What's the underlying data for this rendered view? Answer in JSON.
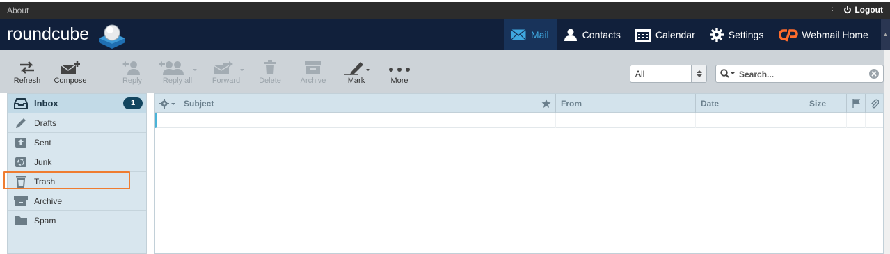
{
  "topbar": {
    "about": "About",
    "separator": ":",
    "logout": "Logout"
  },
  "header": {
    "logo": "roundcube",
    "nav": [
      {
        "label": "Mail",
        "icon": "mail-icon",
        "active": true
      },
      {
        "label": "Contacts",
        "icon": "contacts-icon"
      },
      {
        "label": "Calendar",
        "icon": "calendar-icon"
      },
      {
        "label": "Settings",
        "icon": "gear-icon"
      },
      {
        "label": "Webmail Home",
        "icon": "cpanel-icon"
      }
    ]
  },
  "toolbar": {
    "refresh": "Refresh",
    "compose": "Compose",
    "reply": "Reply",
    "reply_all": "Reply all",
    "forward": "Forward",
    "delete": "Delete",
    "archive": "Archive",
    "mark": "Mark",
    "more": "More",
    "filter_value": "All",
    "search_placeholder": "Search..."
  },
  "folders": [
    {
      "label": "Inbox",
      "icon": "inbox-icon",
      "unread": "1"
    },
    {
      "label": "Drafts",
      "icon": "pencil-icon"
    },
    {
      "label": "Sent",
      "icon": "sent-icon"
    },
    {
      "label": "Junk",
      "icon": "junk-icon"
    },
    {
      "label": "Trash",
      "icon": "trash-icon"
    },
    {
      "label": "Archive",
      "icon": "archive-icon"
    },
    {
      "label": "Spam",
      "icon": "spam-folder-icon"
    }
  ],
  "list": {
    "columns": {
      "subject": "Subject",
      "from": "From",
      "date": "Date",
      "size": "Size"
    }
  },
  "colors": {
    "header_bg": "#11203b",
    "accent": "#3fa8e0",
    "highlight": "#ef7d31",
    "badge": "#12455f"
  }
}
